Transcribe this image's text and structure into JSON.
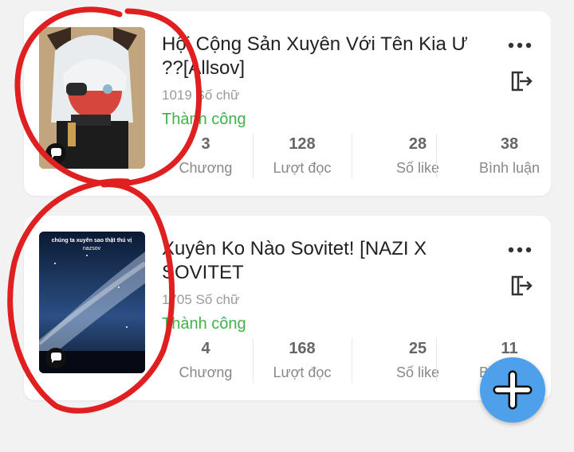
{
  "stories": [
    {
      "title": "Hội Cộng Sản Xuyên Với Tên Kia Ư ??[Allsov]",
      "word_count": "1019 Số chữ",
      "status": "Thành công",
      "stats": [
        {
          "value": "3",
          "label": "Chương"
        },
        {
          "value": "128",
          "label": "Lượt đọc"
        },
        {
          "value": "28",
          "label": "Số like"
        },
        {
          "value": "38",
          "label": "Bình luận"
        }
      ]
    },
    {
      "title": "Xuyên Ko Nào Sovitet! [NAZI X SOVITET",
      "word_count": "1705 Số chữ",
      "status": "Thành công",
      "cover_text_1": "chúng ta xuyên sao thật thú vị",
      "cover_text_2": "nazsov",
      "stats": [
        {
          "value": "4",
          "label": "Chương"
        },
        {
          "value": "168",
          "label": "Lượt đọc"
        },
        {
          "value": "25",
          "label": "Số like"
        },
        {
          "value": "11",
          "label": "Bình luận"
        }
      ]
    }
  ],
  "icons": {
    "more": "more-dots-icon",
    "exit": "exit-icon",
    "comment": "comment-bubble-icon",
    "add": "plus-icon"
  },
  "colors": {
    "status_green": "#3fb24a",
    "fab_blue": "#4ea0ea",
    "annotation_red": "#e02020"
  }
}
